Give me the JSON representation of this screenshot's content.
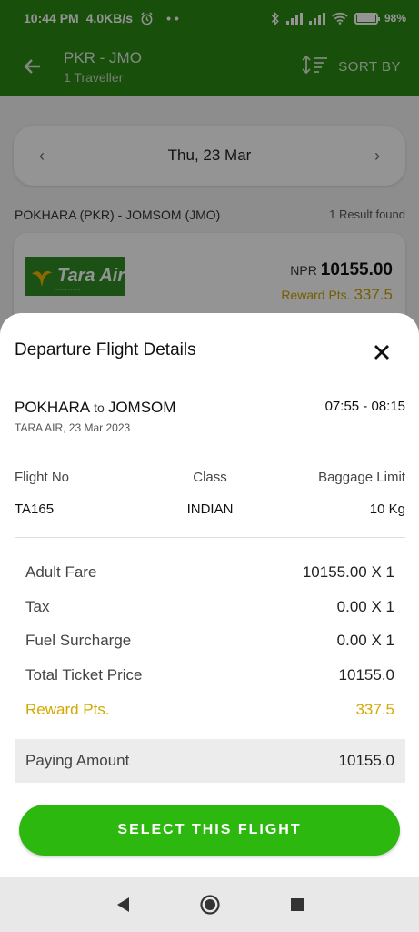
{
  "status_bar": {
    "time": "10:44 PM",
    "speed": "4.0KB/s",
    "dots": "• •",
    "battery": "98",
    "battery_level": 0.98,
    "icons": [
      "alarm-icon",
      "bluetooth-icon",
      "signal-icon",
      "wifi-icon",
      "battery-icon"
    ]
  },
  "app_bar": {
    "route": "PKR - JMO",
    "travellers": "1 Traveller",
    "sort_label": "SORT BY"
  },
  "date_nav": {
    "date": "Thu, 23 Mar",
    "prev": "‹",
    "next": "›"
  },
  "results": {
    "route_label": "POKHARA (PKR) - JOMSOM (JMO)",
    "count": "1 Result found",
    "card": {
      "airline_logo": "Tara Air",
      "currency": "NPR",
      "price": "10155.00",
      "reward_label": "Reward Pts.",
      "reward_value": "337.5"
    }
  },
  "sheet": {
    "title": "Departure Flight Details",
    "from": "POKHARA",
    "to_word": "to",
    "to": "JOMSOM",
    "time_range": "07:55 - 08:15",
    "airline_date": "TARA AIR, 23 Mar 2023",
    "meta_headers": {
      "flight_no": "Flight No",
      "class": "Class",
      "baggage": "Baggage Limit"
    },
    "meta_values": {
      "flight_no": "TA165",
      "class": "INDIAN",
      "baggage": "10 Kg"
    },
    "fares": [
      {
        "label": "Adult Fare",
        "value": "10155.00 X 1"
      },
      {
        "label": "Tax",
        "value": "0.00 X 1"
      },
      {
        "label": "Fuel Surcharge",
        "value": "0.00 X 1"
      },
      {
        "label": "Total Ticket Price",
        "value": "10155.0"
      },
      {
        "label": "Reward Pts.",
        "value": "337.5"
      }
    ],
    "paying": {
      "label": "Paying Amount",
      "value": "10155.0"
    },
    "button": "SELECT THIS FLIGHT"
  },
  "colors": {
    "app_green": "#2a8a14",
    "button_green": "#2db80f",
    "reward_gold": "#d4a800"
  }
}
